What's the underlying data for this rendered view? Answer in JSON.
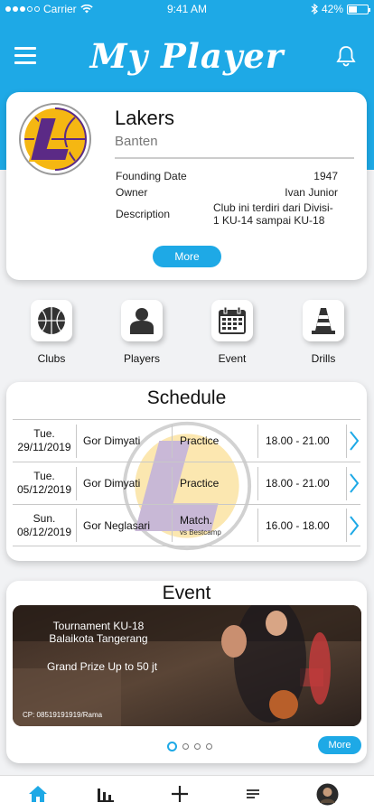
{
  "status_bar": {
    "carrier": "Carrier",
    "time": "9:41 AM",
    "battery": "42%"
  },
  "header": {
    "title": "My Player",
    "menu_icon": "hamburger-menu-icon",
    "notification_icon": "bell-icon"
  },
  "club": {
    "name": "Lakers",
    "region": "Banten",
    "founding_label": "Founding Date",
    "founding_value": "1947",
    "owner_label": "Owner",
    "owner_value": "Ivan Junior",
    "description_label": "Description",
    "description_value": "Club ini terdiri dari Divisi-1 KU-14 sampai KU-18",
    "more_label": "More",
    "colors": {
      "purple": "#5b2a86",
      "gold": "#f5b712"
    }
  },
  "menu": [
    {
      "label": "Clubs",
      "icon": "basketball-icon"
    },
    {
      "label": "Players",
      "icon": "person-icon"
    },
    {
      "label": "Event",
      "icon": "calendar-icon"
    },
    {
      "label": "Drills",
      "icon": "traffic-cone-icon"
    }
  ],
  "schedule": {
    "title": "Schedule",
    "rows": [
      {
        "day": "Tue.",
        "date": "29/11/2019",
        "place": "Gor Dimyati",
        "type": "Practice",
        "sub": "",
        "time": "18.00 - 21.00"
      },
      {
        "day": "Tue.",
        "date": "05/12/2019",
        "place": "Gor Dimyati",
        "type": "Practice",
        "sub": "",
        "time": "18.00 - 21.00"
      },
      {
        "day": "Sun.",
        "date": "08/12/2019",
        "place": "Gor Neglasari",
        "type": "Match.",
        "sub": "vs Bestcamp",
        "time": "16.00 - 18.00"
      }
    ]
  },
  "event": {
    "title": "Event",
    "banner_line1": "Tournament KU-18",
    "banner_line2": "Balaikota Tangerang",
    "banner_prize": "Grand Prize Up to 50 jt",
    "banner_contact": "CP: 08519191919/Rama",
    "more_label": "More",
    "pages": 4,
    "active_page": 1
  },
  "bottom_nav": [
    {
      "icon": "home-icon",
      "active": true
    },
    {
      "icon": "bar-chart-icon",
      "active": false
    },
    {
      "icon": "plus-icon",
      "active": false
    },
    {
      "icon": "list-icon",
      "active": false
    },
    {
      "icon": "profile-avatar",
      "active": false
    }
  ],
  "colors": {
    "primary": "#1ea9e6",
    "background": "#f1f2f4"
  }
}
